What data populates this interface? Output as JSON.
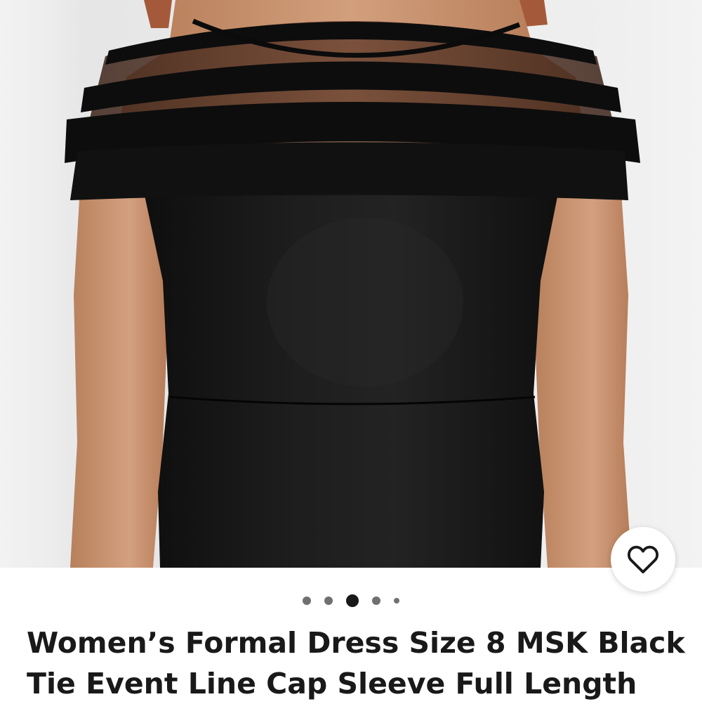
{
  "listing": {
    "title": "Women’s Formal Dress Size 8 MSK Black Tie Event Line Cap Sleeve Full Length",
    "image_description_icon": "product-photo"
  },
  "gallery": {
    "image_count": 5,
    "active_index": 2
  },
  "favorite": {
    "icon": "heart-icon"
  },
  "colors": {
    "text": "#191919",
    "dot_inactive": "#707070",
    "dot_active": "#191919",
    "dress": "#141414",
    "skin": "#c48d68"
  }
}
